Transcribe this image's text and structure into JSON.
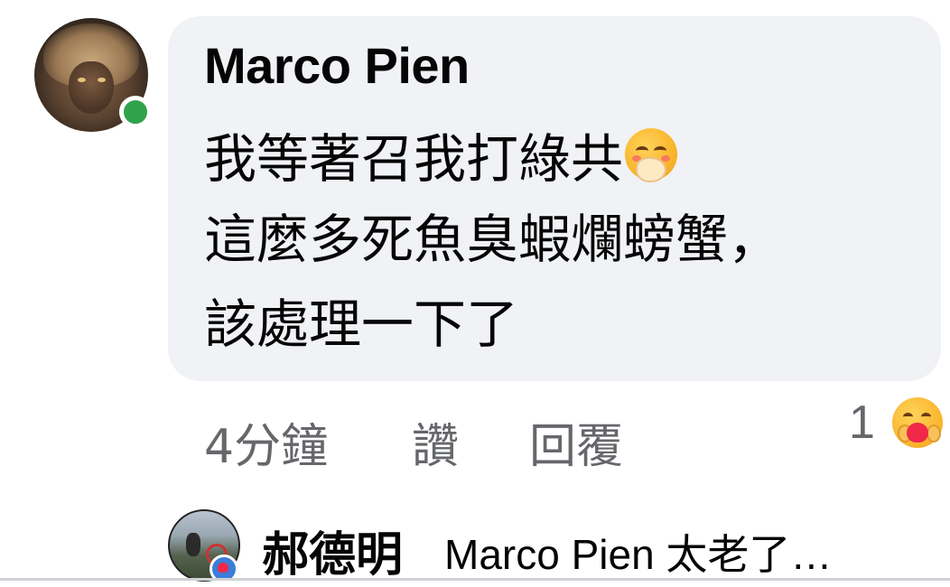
{
  "comment": {
    "author": "Marco Pien",
    "lines": [
      "我等著召我打綠共",
      "這麼多死魚臭蝦爛螃蟹，",
      "該處理一下了"
    ],
    "trailing_emoji": "face-with-hand-over-mouth-emoji",
    "online": true
  },
  "actions": {
    "time": "4分鐘",
    "like": "讚",
    "reply": "回覆"
  },
  "reactions": {
    "count": "1",
    "emoji": "care-hug-emoji"
  },
  "reply_preview": {
    "author": "郝德明",
    "text": "Marco Pien 太老了…"
  },
  "colors": {
    "bubble": "#f0f2f5",
    "online": "#31a24c",
    "meta_text": "#65676b"
  }
}
